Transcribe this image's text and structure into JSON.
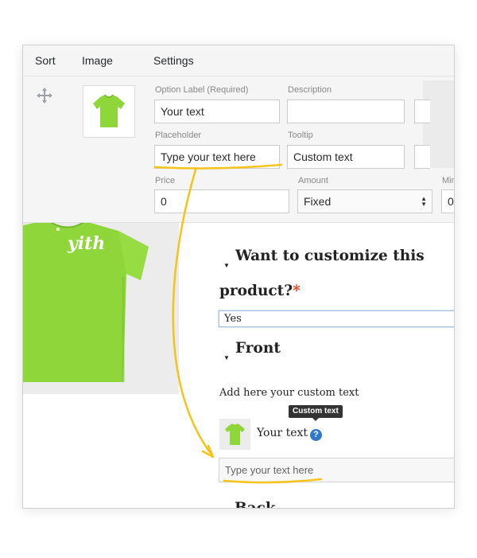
{
  "admin": {
    "header": {
      "sort": "Sort",
      "image": "Image",
      "settings": "Settings"
    },
    "fields": {
      "option_label": {
        "label": "Option Label (Required)",
        "value": "Your text"
      },
      "description": {
        "label": "Description",
        "value": ""
      },
      "placeholder": {
        "label": "Placeholder",
        "value": "Type your text here"
      },
      "tooltip": {
        "label": "Tooltip",
        "value": "Custom text"
      },
      "price": {
        "label": "Price",
        "value": "0"
      },
      "amount": {
        "label": "Amount",
        "value": "Fixed"
      },
      "min": {
        "label": "Min",
        "value": "0"
      }
    }
  },
  "front": {
    "question_line1": "Want to customize this",
    "question_line2": "product?",
    "required_mark": "*",
    "yes_value": "Yes",
    "section_title": "Front",
    "custom_text_label": "Add here your custom text",
    "tooltip_text": "Custom text",
    "option_label": "Your text",
    "help_glyph": "?",
    "input_placeholder": "Type your text here",
    "next_title_partial": "Back"
  },
  "product_shirt_text": "yith",
  "colors": {
    "accent_yellow": "#f5c31a",
    "shirt_green": "#8fd63a",
    "help_blue": "#2e7ac9",
    "required_red": "#e2401c"
  }
}
